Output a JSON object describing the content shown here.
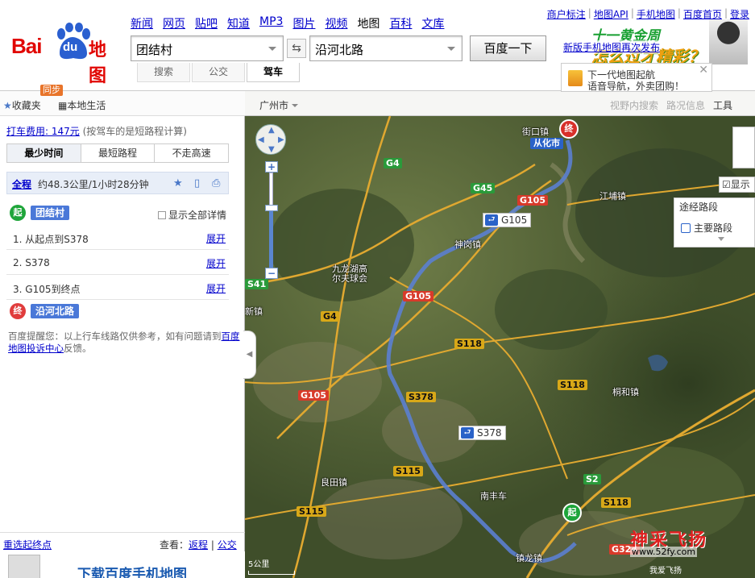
{
  "logo": {
    "brand": "Bai",
    "du": "du",
    "suffix": "地图"
  },
  "topnav": [
    {
      "label": "新闻",
      "current": false
    },
    {
      "label": "网页",
      "current": false
    },
    {
      "label": "贴吧",
      "current": false
    },
    {
      "label": "知道",
      "current": false
    },
    {
      "label": "MP3",
      "current": false
    },
    {
      "label": "图片",
      "current": false
    },
    {
      "label": "视频",
      "current": false
    },
    {
      "label": "地图",
      "current": true
    },
    {
      "label": "百科",
      "current": false
    },
    {
      "label": "文库",
      "current": false
    }
  ],
  "userlinks": [
    "商户标注",
    "地图API",
    "手机地图",
    "百度首页",
    "登录"
  ],
  "search": {
    "start": "团结村",
    "end": "沿河北路",
    "swap": "⇆",
    "button": "百度一下"
  },
  "modes": [
    {
      "label": "搜索",
      "current": false
    },
    {
      "label": "公交",
      "current": false
    },
    {
      "label": "驾车",
      "current": true
    }
  ],
  "ad_top": {
    "line1": "十一黄金周",
    "line2": "怎么过才精彩？",
    "link": "新版手机地图再次发布"
  },
  "nav_ad": {
    "line1": "下一代地图起航",
    "line2": "语音导航，外卖团购！",
    "close": "✕"
  },
  "subbar": {
    "favorites": "收藏夹",
    "local": "本地生活",
    "sync_badge": "同步"
  },
  "panel": {
    "taxi_link": "打车费用: 147元",
    "taxi_note": "(按驾车的是短路程计算)",
    "tabs": [
      {
        "label": "最少时间",
        "current": true
      },
      {
        "label": "最短路程",
        "current": false
      },
      {
        "label": "不走高速",
        "current": false
      }
    ],
    "summary_label": "全程",
    "summary_info": "约48.3公里/1小时28分钟",
    "start_marker": "起",
    "start_name": "团结村",
    "show_all": "显示全部详情",
    "steps": [
      {
        "text": "1. 从起点到S378",
        "expand": "展开"
      },
      {
        "text": "2. S378",
        "expand": "展开"
      },
      {
        "text": "3. G105到终点",
        "expand": "展开"
      }
    ],
    "end_marker": "终",
    "end_name": "沿河北路",
    "tip_prefix": "百度提醒您：以上行车线路仅供参考，如有问题请到",
    "tip_link": "百度地图投诉中心",
    "tip_suffix": "反馈。",
    "reselect": "重选起终点",
    "view_label": "查看：",
    "view_near": "返程",
    "view_bus": "公交",
    "app_ad": "下载百度手机地图"
  },
  "map": {
    "city": "广州市",
    "tools": [
      {
        "label": "视野内搜索",
        "dark": false
      },
      {
        "label": "路况信息",
        "dark": false
      },
      {
        "label": "工具",
        "dark": true
      }
    ],
    "show_checkbox": "☑显示",
    "waypoints_header": "途经路段",
    "waypoints_item": "主要路段",
    "city_tag": "从化市",
    "end_pin": "终",
    "start_pin": "起",
    "route_tags": [
      "G105",
      "S378"
    ],
    "road_labels": [
      "G4",
      "G45",
      "G105",
      "S41",
      "G4",
      "G105",
      "G105",
      "S118",
      "S378",
      "S118",
      "S115",
      "S115",
      "S2",
      "S118",
      "G324"
    ],
    "places": [
      "街口镇",
      "江埔镇",
      "神岗镇",
      "九龙湖高尔夫球会",
      "新镇",
      "桐和镇",
      "良田镇",
      "南丰车",
      "镇龙镇"
    ],
    "scale": "5公里",
    "watermark": "神采飞扬",
    "watermark_url": "www.52fy.com",
    "watermark_sub": "我爱飞扬"
  },
  "colors": {
    "route": "#5b7fd0",
    "brand_red": "#e10602",
    "link": "#0000cc"
  }
}
